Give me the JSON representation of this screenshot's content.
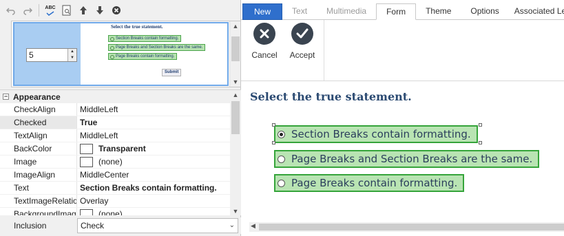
{
  "toolbar": {
    "icons": [
      "undo-icon",
      "redo-icon",
      "spellcheck-icon",
      "preview-icon",
      "move-up-icon",
      "move-down-icon",
      "delete-icon"
    ],
    "spellcheck_label": "ABC"
  },
  "preview": {
    "spin_value": "5",
    "title": "Select the true statement.",
    "options": [
      "Section Breaks contain formatting.",
      "Page Breaks and Section Breaks are the same.",
      "Page Breaks contain formatting."
    ],
    "submit": "Submit"
  },
  "properties": {
    "category": "Appearance",
    "rows": [
      {
        "name": "CheckAlign",
        "value": "MiddleLeft",
        "bold": false,
        "swatch": false
      },
      {
        "name": "Checked",
        "value": "True",
        "bold": true,
        "swatch": false
      },
      {
        "name": "TextAlign",
        "value": "MiddleLeft",
        "bold": false,
        "swatch": false
      },
      {
        "name": "BackColor",
        "value": "Transparent",
        "bold": true,
        "swatch": true
      },
      {
        "name": "Image",
        "value": "(none)",
        "bold": false,
        "swatch": true
      },
      {
        "name": "ImageAlign",
        "value": "MiddleCenter",
        "bold": false,
        "swatch": false
      },
      {
        "name": "Text",
        "value": "Section Breaks contain formatting.",
        "bold": true,
        "swatch": false
      },
      {
        "name": "TextImageRelation",
        "value": "Overlay",
        "bold": false,
        "swatch": false
      },
      {
        "name": "BackgroundImage",
        "value": "(none)",
        "bold": false,
        "swatch": true
      }
    ]
  },
  "inclusion": {
    "label": "Inclusion",
    "value": "Check"
  },
  "tabs": {
    "new": "New",
    "text": "Text",
    "multimedia": "Multimedia",
    "form": "Form",
    "theme": "Theme",
    "options": "Options",
    "associated": "Associated Learning"
  },
  "ribbon": {
    "cancel": "Cancel",
    "accept": "Accept"
  },
  "question": {
    "title": "Select the true statement.",
    "options": [
      {
        "label": "Section Breaks contain formatting.",
        "selected": true
      },
      {
        "label": "Page Breaks and Section Breaks are the same.",
        "selected": false
      },
      {
        "label": "Page Breaks contain formatting.",
        "selected": false
      }
    ]
  },
  "colors": {
    "accent": "#2f6fcc",
    "option_fill": "#b9e4b3",
    "option_border": "#35a43a",
    "title": "#2b4a72"
  }
}
